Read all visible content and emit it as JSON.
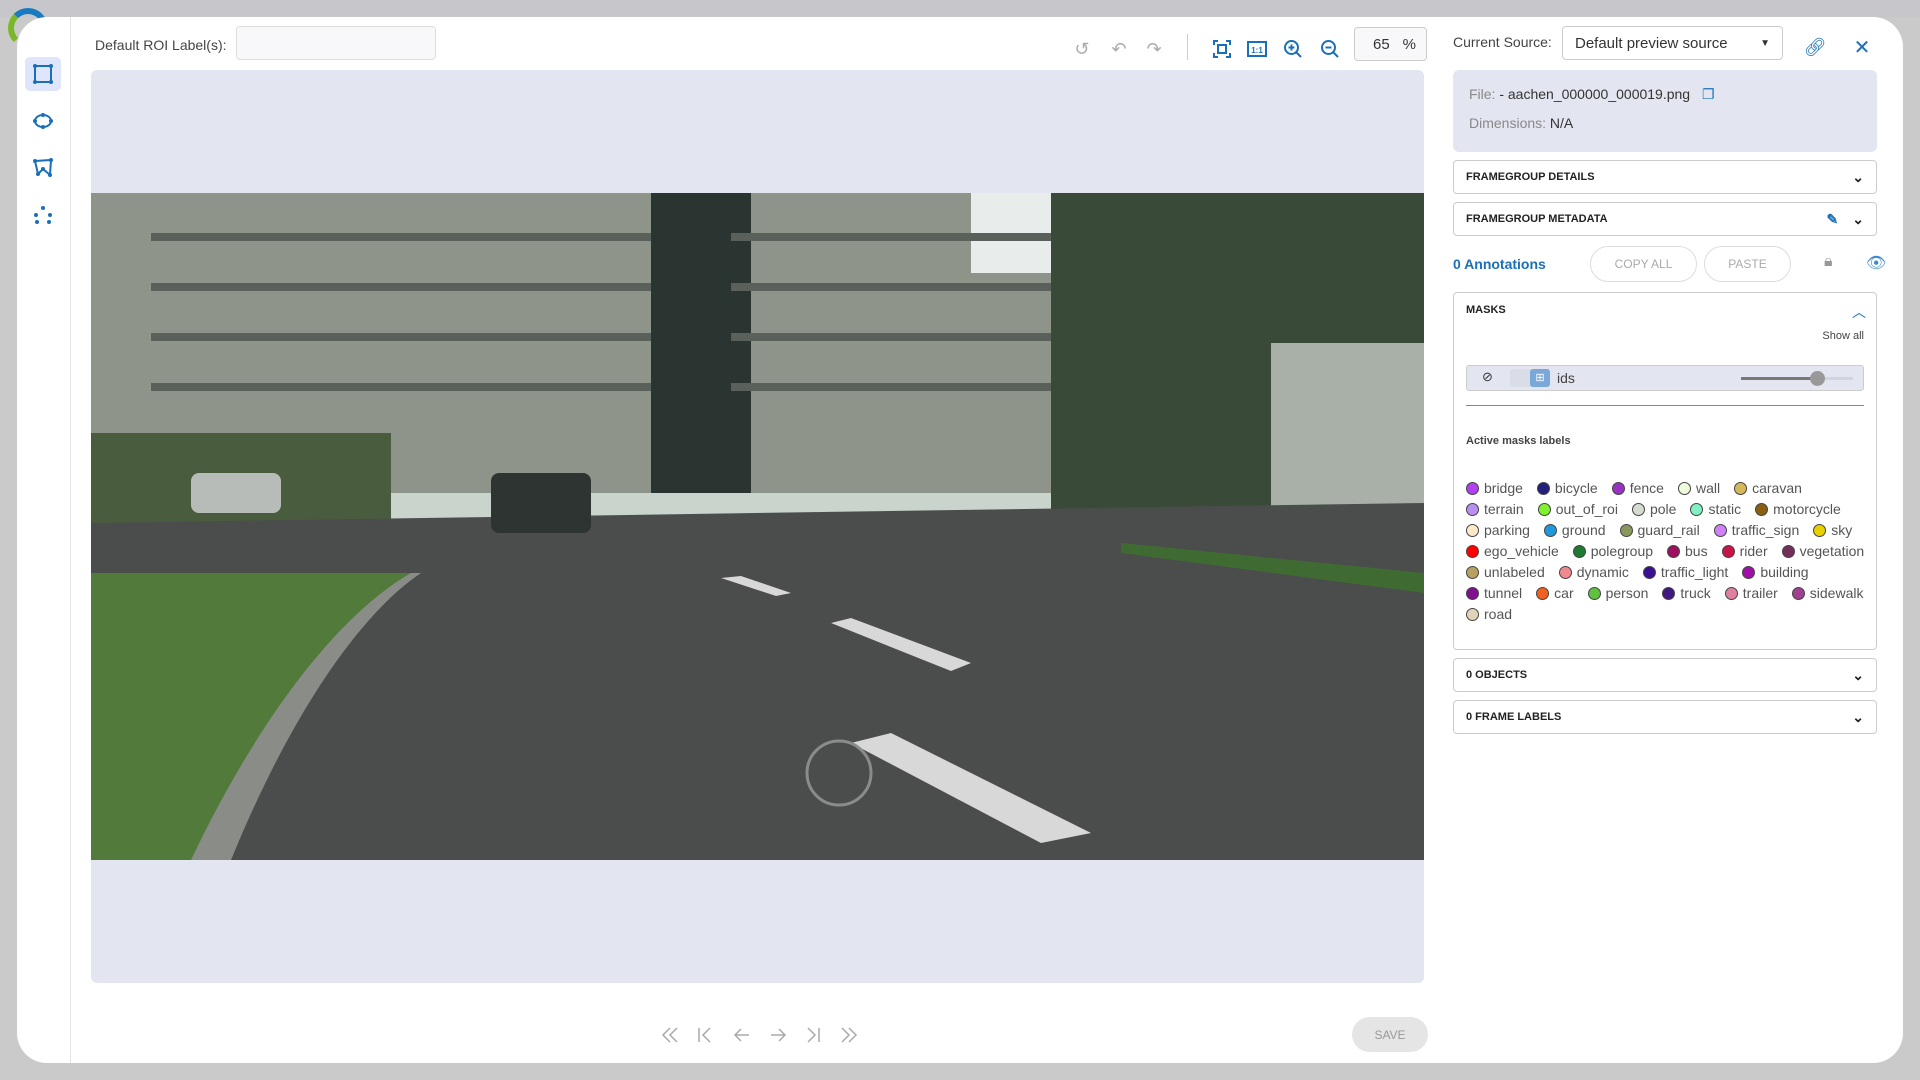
{
  "header": {
    "roi_label": "Default ROI Label(s):",
    "roi_value": "",
    "zoom_value": "65",
    "zoom_unit": "%",
    "source_label": "Current Source:",
    "source_value": "Default preview source"
  },
  "tools": [
    "rectangle-tool",
    "ellipse-tool",
    "polygon-tool",
    "points-tool"
  ],
  "file": {
    "file_key": "File:",
    "file_value": "- aachen_000000_000019.png",
    "dim_key": "Dimensions:",
    "dim_value": "N/A"
  },
  "sections": {
    "details": "FRAMEGROUP DETAILS",
    "metadata": "FRAMEGROUP METADATA",
    "objects": "0 OBJECTS",
    "frame_labels": "0 FRAME LABELS"
  },
  "annotations": {
    "count": "0 Annotations",
    "copy_all": "COPY ALL",
    "paste": "PASTE"
  },
  "masks": {
    "title": "MASKS",
    "show_all": "Show all",
    "layer_name": "ids",
    "opacity": 0.68,
    "active_title": "Active masks labels",
    "labels": [
      {
        "name": "bridge",
        "color": "#b040f0"
      },
      {
        "name": "bicycle",
        "color": "#22207a"
      },
      {
        "name": "fence",
        "color": "#9932c0"
      },
      {
        "name": "wall",
        "color": "#eefadc"
      },
      {
        "name": "caravan",
        "color": "#d4b85a"
      },
      {
        "name": "terrain",
        "color": "#b890f0"
      },
      {
        "name": "out_of_roi",
        "color": "#80f030"
      },
      {
        "name": "pole",
        "color": "#d4dcd0"
      },
      {
        "name": "static",
        "color": "#80f0c0"
      },
      {
        "name": "motorcycle",
        "color": "#8a6010"
      },
      {
        "name": "parking",
        "color": "#fde8c8"
      },
      {
        "name": "ground",
        "color": "#2098e0"
      },
      {
        "name": "guard_rail",
        "color": "#88985a"
      },
      {
        "name": "traffic_sign",
        "color": "#d080f8"
      },
      {
        "name": "sky",
        "color": "#e8d000"
      },
      {
        "name": "ego_vehicle",
        "color": "#ff0000"
      },
      {
        "name": "polegroup",
        "color": "#1e7a30"
      },
      {
        "name": "bus",
        "color": "#a01060"
      },
      {
        "name": "rider",
        "color": "#c81448"
      },
      {
        "name": "vegetation",
        "color": "#70305a"
      },
      {
        "name": "unlabeled",
        "color": "#b8a060"
      },
      {
        "name": "dynamic",
        "color": "#f08890"
      },
      {
        "name": "traffic_light",
        "color": "#3a1090"
      },
      {
        "name": "building",
        "color": "#a010a8"
      },
      {
        "name": "tunnel",
        "color": "#801090"
      },
      {
        "name": "car",
        "color": "#f06020"
      },
      {
        "name": "person",
        "color": "#60c040"
      },
      {
        "name": "truck",
        "color": "#401880"
      },
      {
        "name": "trailer",
        "color": "#e080a0"
      },
      {
        "name": "sidewalk",
        "color": "#a04090"
      },
      {
        "name": "road",
        "color": "#e0d4b8"
      }
    ]
  },
  "footer": {
    "save": "SAVE"
  },
  "colors": {
    "accent": "#1a6fb8",
    "panel": "#e3e6f0"
  }
}
